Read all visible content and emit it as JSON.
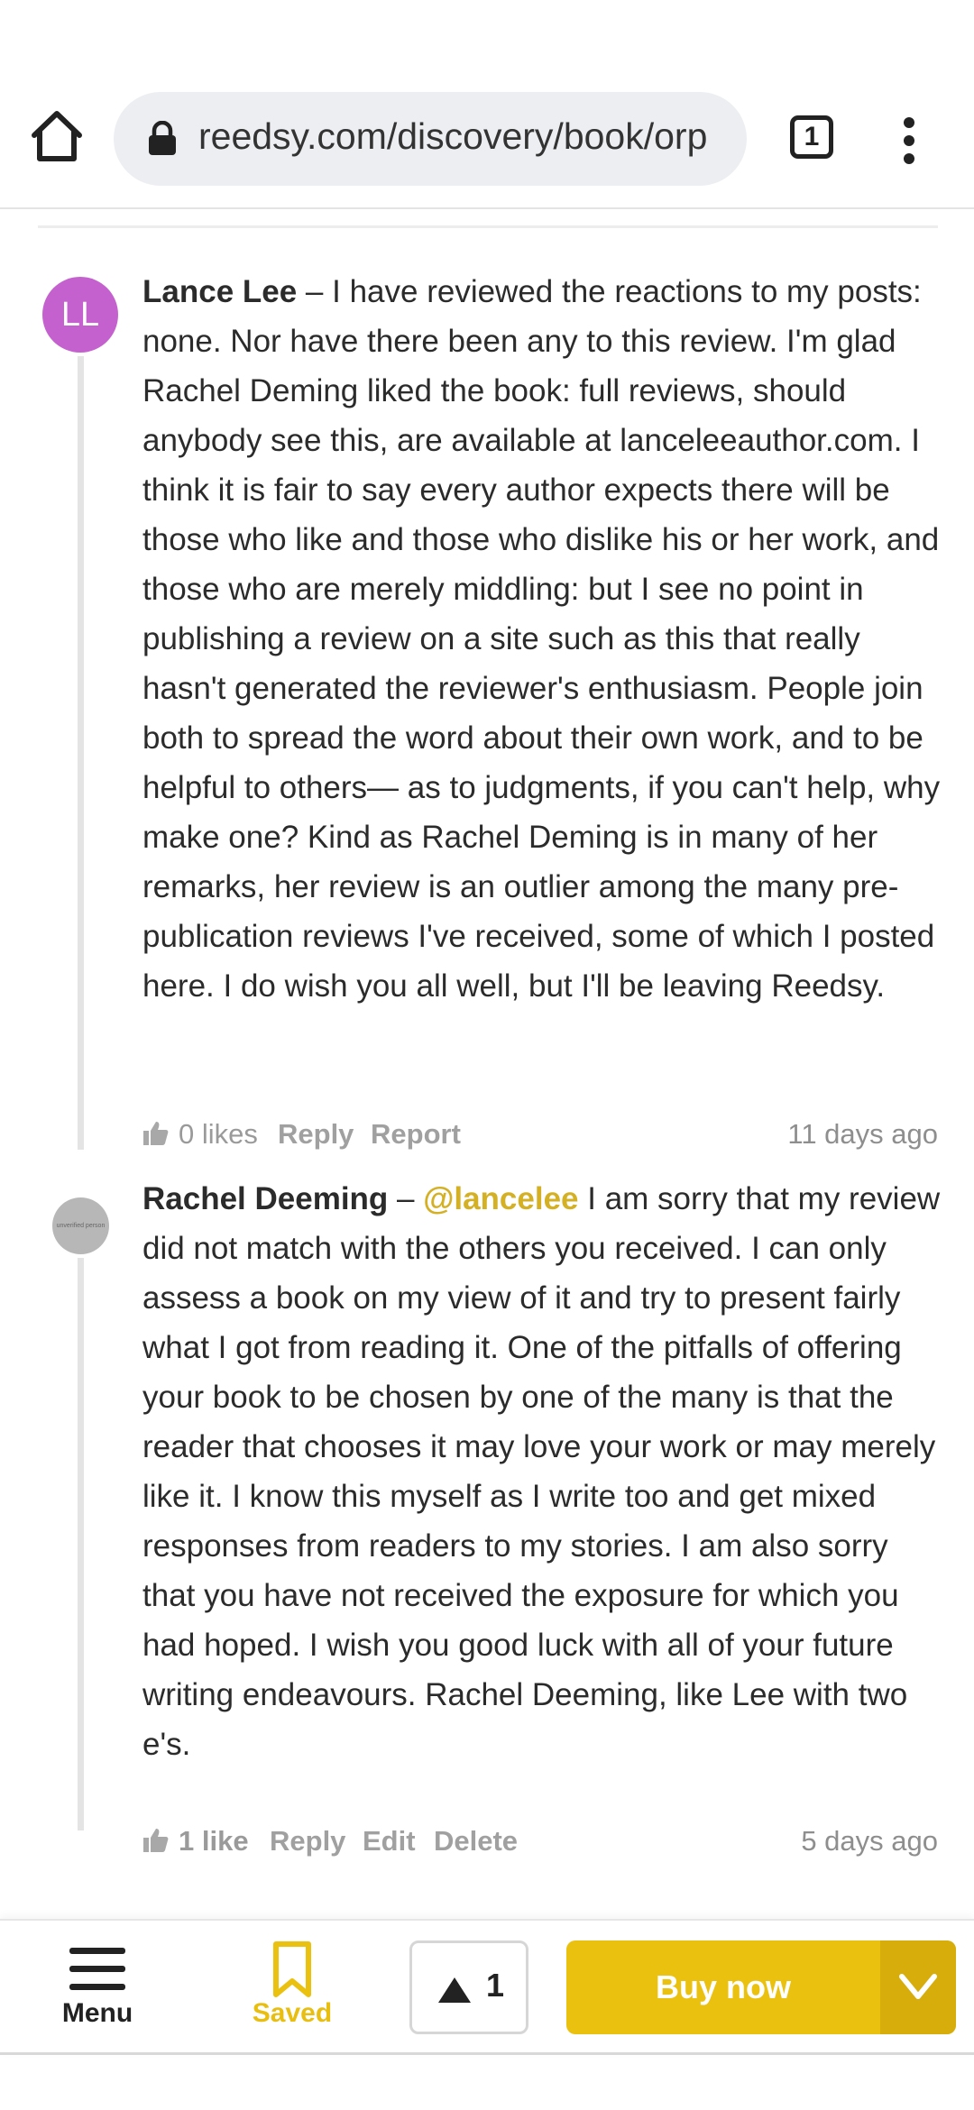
{
  "browser": {
    "url": "reedsy.com/discovery/book/orp",
    "tab_count": "1"
  },
  "comments": [
    {
      "avatar_initials": "LL",
      "author": "Lance Lee",
      "separator": " – ",
      "mention": "",
      "text": "I have reviewed the reactions to my posts: none. Nor have there been any to this review. I'm glad Rachel Deming liked the book: full reviews, should anybody see this, are available at lanceleeauthor.com. I think it is fair to say every author expects there will be those who like and those who dislike his or her work, and those who are merely middling: but I see no point in publishing a review on a site such as this that really hasn't generated the reviewer's enthusiasm. People join both to spread the word about their own work, and to be helpful to others— as to judgments, if you can't help, why make one? Kind as Rachel Deming is in many of her remarks, her review is an outlier among the many pre-publication reviews I've received, some of which I posted here. I do wish you all well, but I'll be leaving Reedsy.",
      "likes": "0 likes",
      "actions": [
        "Reply",
        "Report"
      ],
      "time": "11 days ago"
    },
    {
      "avatar_initials": "unverified person",
      "author": "Rachel Deeming",
      "separator": " – ",
      "mention": "@lancelee",
      "text": "I am sorry that my review did not match with the others you received. I can only assess a book on my view of it and try to present fairly what I got from reading it. One of the pitfalls of offering your book to be chosen by one of the many is that the reader that chooses it may love your work or may merely like it. I know this myself as I write too and get mixed responses from readers to my stories. I am also sorry that you have not received the exposure for which you had hoped. I wish you good luck with all of your future writing endeavours. Rachel Deeming, like Lee with two e's.",
      "likes": "1 like",
      "actions": [
        "Reply",
        "Edit",
        "Delete"
      ],
      "time": "5 days ago"
    }
  ],
  "bottom_bar": {
    "menu_label": "Menu",
    "saved_label": "Saved",
    "upvote_count": "1",
    "buy_label": "Buy now"
  },
  "colors": {
    "accent_yellow": "#ebc10f",
    "avatar_purple": "#c561cf",
    "mention": "#d4b024"
  },
  "icons": [
    "home-icon",
    "lock-icon",
    "tabs-icon",
    "kebab-menu-icon",
    "thumbs-up-icon",
    "menu-icon",
    "bookmark-icon",
    "upvote-arrow-icon",
    "chevron-down-icon"
  ]
}
